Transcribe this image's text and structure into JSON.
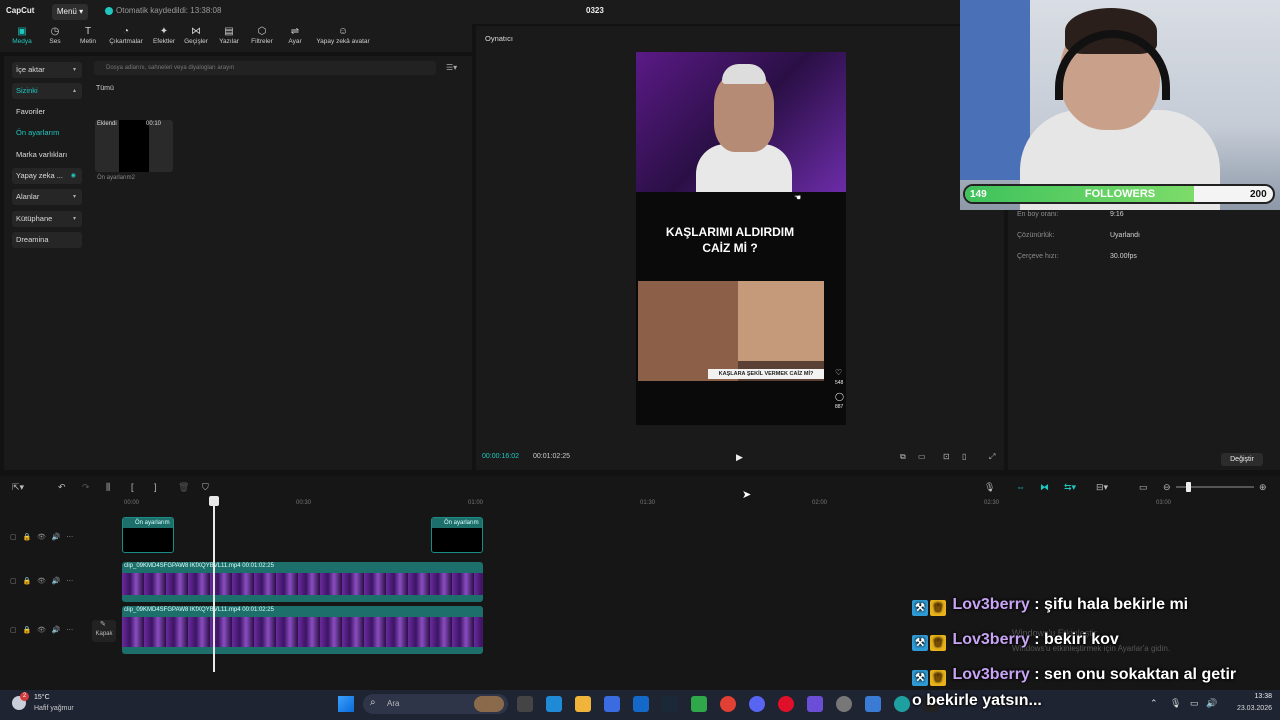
{
  "titlebar": {
    "logo": "CapCut",
    "menu": "Menü",
    "autosave": "Otomatik kaydedildi: 13:38:08",
    "project": "0323"
  },
  "toolbar": {
    "items": [
      {
        "label": "Medya",
        "icon": "media-icon",
        "glyph": "▣"
      },
      {
        "label": "Ses",
        "icon": "audio-icon",
        "glyph": "◷"
      },
      {
        "label": "Metin",
        "icon": "text-icon",
        "glyph": "T"
      },
      {
        "label": "Çıkartmalar",
        "icon": "sticker-icon",
        "glyph": "◔"
      },
      {
        "label": "Efektler",
        "icon": "effects-icon",
        "glyph": "✦"
      },
      {
        "label": "Geçişler",
        "icon": "transitions-icon",
        "glyph": "⋈"
      },
      {
        "label": "Yazılar",
        "icon": "captions-icon",
        "glyph": "▤"
      },
      {
        "label": "Filtreler",
        "icon": "filters-icon",
        "glyph": "⬡"
      },
      {
        "label": "Ayar",
        "icon": "adjust-icon",
        "glyph": "⇌"
      },
      {
        "label": "Yapay zekâ avatar",
        "icon": "ai-avatar-icon",
        "glyph": "☺"
      }
    ]
  },
  "sidebar": {
    "items": [
      {
        "label": "İçe aktar"
      },
      {
        "label": "Sizinki"
      },
      {
        "label": "Favoriler"
      },
      {
        "label": "Ön ayarlarım"
      },
      {
        "label": "Marka varlıkları"
      },
      {
        "label": "Yapay zeka ..."
      },
      {
        "label": "Alanlar"
      },
      {
        "label": "Kütüphane"
      },
      {
        "label": "Dreamina"
      }
    ]
  },
  "media": {
    "search_placeholder": "Dosya adlarını, sahneleri veya diyalogları arayın",
    "filter": "Tümü",
    "thumb_status": "Eklendi",
    "thumb_duration": "00:10",
    "thumb_name": "Ön ayarlarım2"
  },
  "player": {
    "title": "Oynatıcı",
    "headline_1": "KAŞLARIMI ALDIRDIM",
    "headline_2": "CAİZ Mİ ?",
    "clip_caption": "KAŞLARA ŞEKİL VERMEK CAİZ Mİ?",
    "like_count": "548",
    "comment_count": "887",
    "time_current": "00:00:16:02",
    "time_total": "00:01:02:25"
  },
  "properties": {
    "rows": [
      {
        "key": "En boy oranı:",
        "value": "9:16"
      },
      {
        "key": "Çözünürlük:",
        "value": "Uyarlandı"
      },
      {
        "key": "Çerçeve hızı:",
        "value": "30.00fps"
      }
    ],
    "change_button": "Değiştir"
  },
  "followers": {
    "current": "149",
    "label": "FOLLOWERS",
    "goal": "200",
    "progress": 0.745
  },
  "timeline": {
    "ruler": [
      "00:00",
      "00:30",
      "01:00",
      "01:30",
      "02:00",
      "02:30",
      "03:00"
    ],
    "preset_clip": "Ön ayarlarım",
    "video_clip_1": "clip_09KMD4SFGPAW8 lKfXQYBVL11.mp4   00:01:02:25",
    "video_clip_2": "clip_09KMD4SFGPAW8 lKfXQYBVL11.mp4   00:01:02:25",
    "cover": "Kapak"
  },
  "chat": [
    {
      "user": "Lov3berry",
      "text": ": şifu hala bekirle mi"
    },
    {
      "user": "Lov3berry",
      "text": ": bekiri kov"
    },
    {
      "user": "Lov3berry",
      "text": ": sen onu sokaktan al getir"
    },
    {
      "user": "",
      "text": "o bekirle yatsın..."
    }
  ],
  "watermark": {
    "line1": "Windows'u Etkinleştir",
    "line2": "Windows'u etkinleştirmek için Ayarlar'a gidin."
  },
  "taskbar": {
    "temp": "15°C",
    "weather": "Hafif yağmur",
    "weather_badge": "2",
    "search": "Ara",
    "time": "13:38",
    "date": "23.03.2026"
  }
}
